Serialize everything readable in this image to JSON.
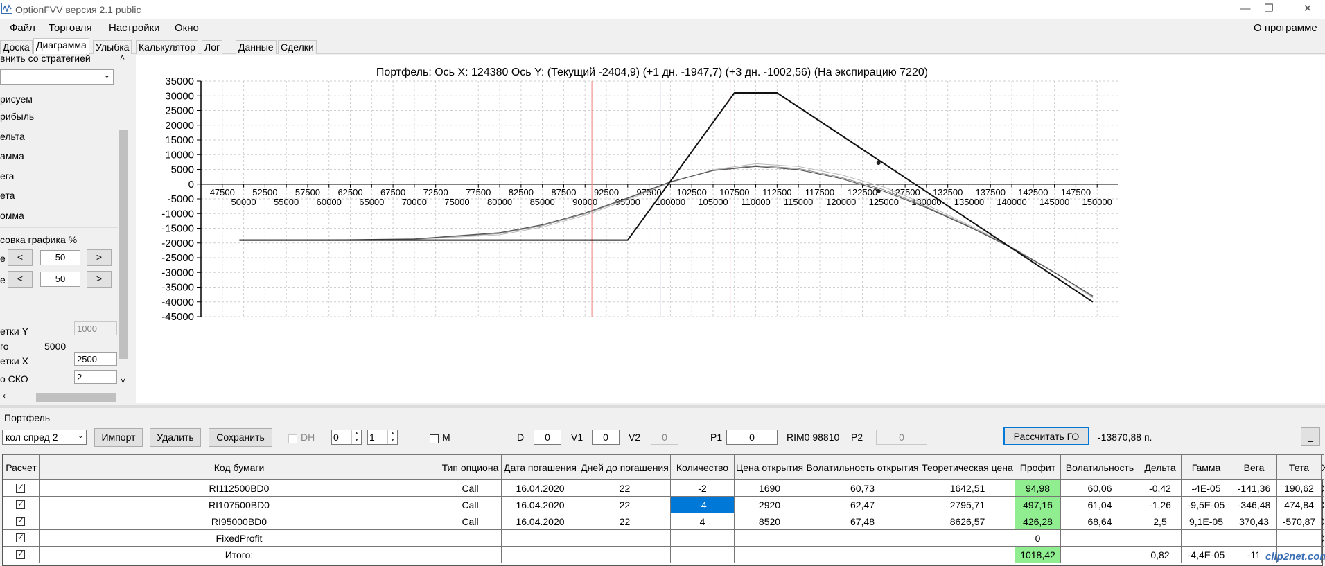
{
  "window": {
    "title": "OptionFVV версия 2.1 public",
    "minimize": "—",
    "restore": "❐",
    "close": "✕"
  },
  "menu": {
    "items": [
      "Файл",
      "Торговля",
      "Настройки",
      "Окно"
    ],
    "about": "О программе"
  },
  "tabs": [
    "Доска",
    "Диаграмма",
    "Улыбка",
    "Калькулятор",
    "Лог",
    "Данные",
    "Сделки"
  ],
  "active_tab": "Диаграмма",
  "left_panel": {
    "compare_label": "внить со стратегией",
    "draw_label": "рисуем",
    "draw_items": [
      "рибыль",
      "ельта",
      "амма",
      "ега",
      "ета",
      "омма"
    ],
    "scale_label": "совка графика %",
    "row1_label": "е",
    "row1_value": "50",
    "row2_label": "е",
    "row2_value": "50",
    "minus": "<",
    "plus": ">",
    "grid_y_label": "етки Y",
    "grid_y_value": "1000",
    "total_label": "го",
    "total_value": "5000",
    "grid_x_label": "етки X",
    "grid_x_value": "2500",
    "sko_label": "о СКО",
    "sko_value": "2"
  },
  "chart_title": "Портфель: Ось X: 124380 Ось Y:  (Текущий -2404,9)  (+1 дн. -1947,7)  (+3 дн. -1002,56)  (На экспирацию 7220)",
  "chart_data": {
    "type": "line",
    "title": "Портфель: Ось X: 124380 Ось Y:  (Текущий -2404,9)  (+1 дн. -1947,7)  (+3 дн. -1002,56)  (На экспирацию 7220)",
    "xlim": [
      45000,
      152500
    ],
    "ylim": [
      -45000,
      35000
    ],
    "y_ticks": [
      35000,
      30000,
      25000,
      20000,
      15000,
      10000,
      5000,
      0,
      -5000,
      -10000,
      -15000,
      -20000,
      -25000,
      -30000,
      -35000,
      -40000,
      -45000
    ],
    "x_ticks_top": [
      47500,
      52500,
      57500,
      62500,
      67500,
      72500,
      77500,
      82500,
      87500,
      92500,
      97500,
      102500,
      107500,
      112500,
      117500,
      122500,
      127500,
      132500,
      137500,
      142500,
      147500
    ],
    "x_ticks_bottom": [
      50000,
      55000,
      60000,
      65000,
      70000,
      75000,
      80000,
      85000,
      90000,
      95000,
      100000,
      105000,
      110000,
      115000,
      120000,
      125000,
      130000,
      135000,
      140000,
      145000,
      150000
    ],
    "grid": true,
    "vertical_markers": [
      {
        "x": 90800,
        "color": "#f08080"
      },
      {
        "x": 98800,
        "color": "#4a5a8a"
      },
      {
        "x": 107000,
        "color": "#f08080"
      }
    ],
    "series": [
      {
        "name": "expiration",
        "color": "#111111",
        "width": 2,
        "x": [
          49500,
          95000,
          107500,
          112500,
          149500
        ],
        "y": [
          -19020,
          -19020,
          31000,
          31000,
          -40000
        ]
      },
      {
        "name": "current",
        "color": "#555555",
        "width": 1.2,
        "x": [
          49500,
          60000,
          70000,
          80000,
          85000,
          90000,
          95000,
          100000,
          105000,
          110000,
          115000,
          120000,
          125000,
          130000,
          135000,
          140000,
          145000,
          149500
        ],
        "y": [
          -19000,
          -18980,
          -18600,
          -16500,
          -13800,
          -9800,
          -4700,
          800,
          4600,
          6000,
          4900,
          1900,
          -2400,
          -8000,
          -14500,
          -21700,
          -30000,
          -38000
        ]
      },
      {
        "name": "+1",
        "color": "#888888",
        "width": 1,
        "x": [
          49500,
          60000,
          70000,
          80000,
          85000,
          90000,
          95000,
          100000,
          105000,
          110000,
          115000,
          120000,
          125000,
          130000,
          135000,
          140000,
          145000,
          149500
        ],
        "y": [
          -19000,
          -18990,
          -18700,
          -16800,
          -14100,
          -10100,
          -4900,
          700,
          4700,
          6300,
          5300,
          2300,
          -1900,
          -7700,
          -14300,
          -21500,
          -29900,
          -38300
        ]
      },
      {
        "name": "+3",
        "color": "#bbbbbb",
        "width": 1,
        "x": [
          49500,
          60000,
          70000,
          80000,
          85000,
          90000,
          95000,
          100000,
          105000,
          110000,
          115000,
          120000,
          125000,
          130000,
          135000,
          140000,
          145000,
          149500
        ],
        "y": [
          -19000,
          -19000,
          -18800,
          -17200,
          -14600,
          -10600,
          -5300,
          500,
          4900,
          6900,
          6000,
          3200,
          -1000,
          -7000,
          -13900,
          -21400,
          -30000,
          -38600
        ]
      }
    ],
    "markers": [
      {
        "x": 124380,
        "y": 7220
      },
      {
        "x": 124380,
        "y": -2405
      }
    ]
  },
  "portfolio": {
    "label": "Портфель",
    "strategy": "кол спред 2",
    "import": "Импорт",
    "delete": "Удалить",
    "save": "Сохранить",
    "dh_label": "DH",
    "spin1": "0",
    "spin2": "1",
    "m_label": "M",
    "d_label": "D",
    "d_value": "0",
    "v1_label": "V1",
    "v1_value": "0",
    "v2_label": "V2",
    "v2_value": "0",
    "p1_label": "P1",
    "p1_value": "0",
    "rim_label": "RIM0 98810",
    "p2_label": "P2",
    "p2_value": "0",
    "calc_go": "Рассчитать ГО",
    "go_value": "-13870,88 п.",
    "minimize_btn": "_"
  },
  "table": {
    "headers": [
      "Расчет",
      "Код бумаги",
      "Тип опциона",
      "Дата погашения",
      "Дней до погашения",
      "Количество",
      "Цена открытия",
      "Волатильность открытия",
      "Теоретическая цена",
      "Профит",
      "Волатильность",
      "Дельта",
      "Гамма",
      "Вега",
      "Тета",
      "X"
    ],
    "rows": [
      {
        "code": "RI112500BD0",
        "type": "Call",
        "date": "16.04.2020",
        "days": "22",
        "qty": "-2",
        "open_price": "1690",
        "open_vol": "60,73",
        "theo": "1642,51",
        "profit": "94,98",
        "vol": "60,06",
        "delta": "-0,42",
        "gamma": "-4E-05",
        "vega": "-141,36",
        "theta": "190,62",
        "x": "X"
      },
      {
        "code": "RI107500BD0",
        "type": "Call",
        "date": "16.04.2020",
        "days": "22",
        "qty": "-4",
        "open_price": "2920",
        "open_vol": "62,47",
        "theo": "2795,71",
        "profit": "497,16",
        "vol": "61,04",
        "delta": "-1,26",
        "gamma": "-9,5E-05",
        "vega": "-346,48",
        "theta": "474,84",
        "x": "X"
      },
      {
        "code": "RI95000BD0",
        "type": "Call",
        "date": "16.04.2020",
        "days": "22",
        "qty": "4",
        "open_price": "8520",
        "open_vol": "67,48",
        "theo": "8626,57",
        "profit": "426,28",
        "vol": "68,64",
        "delta": "2,5",
        "gamma": "9,1E-05",
        "vega": "370,43",
        "theta": "-570,87",
        "x": "X"
      },
      {
        "code": "FixedProfit",
        "type": "",
        "date": "",
        "days": "",
        "qty": "",
        "open_price": "",
        "open_vol": "",
        "theo": "",
        "profit": "0",
        "vol": "",
        "delta": "",
        "gamma": "",
        "vega": "",
        "theta": "",
        "x": "X"
      }
    ],
    "total": {
      "code": "Итого:",
      "profit": "1018,42",
      "delta": "0,82",
      "gamma": "-4,4E-05",
      "vega": "-11"
    }
  },
  "watermark": "clip2net.com"
}
